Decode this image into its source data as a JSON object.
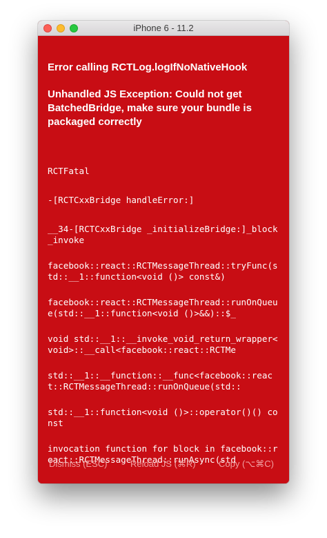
{
  "window": {
    "title": "iPhone 6 - 11.2"
  },
  "error": {
    "title": "Error calling RCTLog.logIfNoNativeHook",
    "message": "Unhandled JS Exception: Could not get BatchedBridge, make sure your bundle is packaged correctly"
  },
  "stack": [
    "RCTFatal",
    "-[RCTCxxBridge handleError:]",
    "__34-[RCTCxxBridge _initializeBridge:]_block_invoke",
    "facebook::react::RCTMessageThread::tryFunc(std::__1::function<void ()> const&)",
    "facebook::react::RCTMessageThread::runOnQueue(std::__1::function<void ()>&&)::$_",
    "void std::__1::__invoke_void_return_wrapper<void>::__call<facebook::react::RCTMe",
    "std::__1::__function::__func<facebook::react::RCTMessageThread::runOnQueue(std::",
    "std::__1::function<void ()>::operator()() const",
    "invocation function for block in facebook::react::RCTMessageThread::runAsync(std"
  ],
  "footer": {
    "dismiss": "Dismiss (ESC)",
    "reload": "Reload JS (⌘R)",
    "copy": "Copy (⌥⌘C)"
  },
  "colors": {
    "background": "#c80d14",
    "text": "#ffffff",
    "footer_text": "#f0a0a2"
  }
}
